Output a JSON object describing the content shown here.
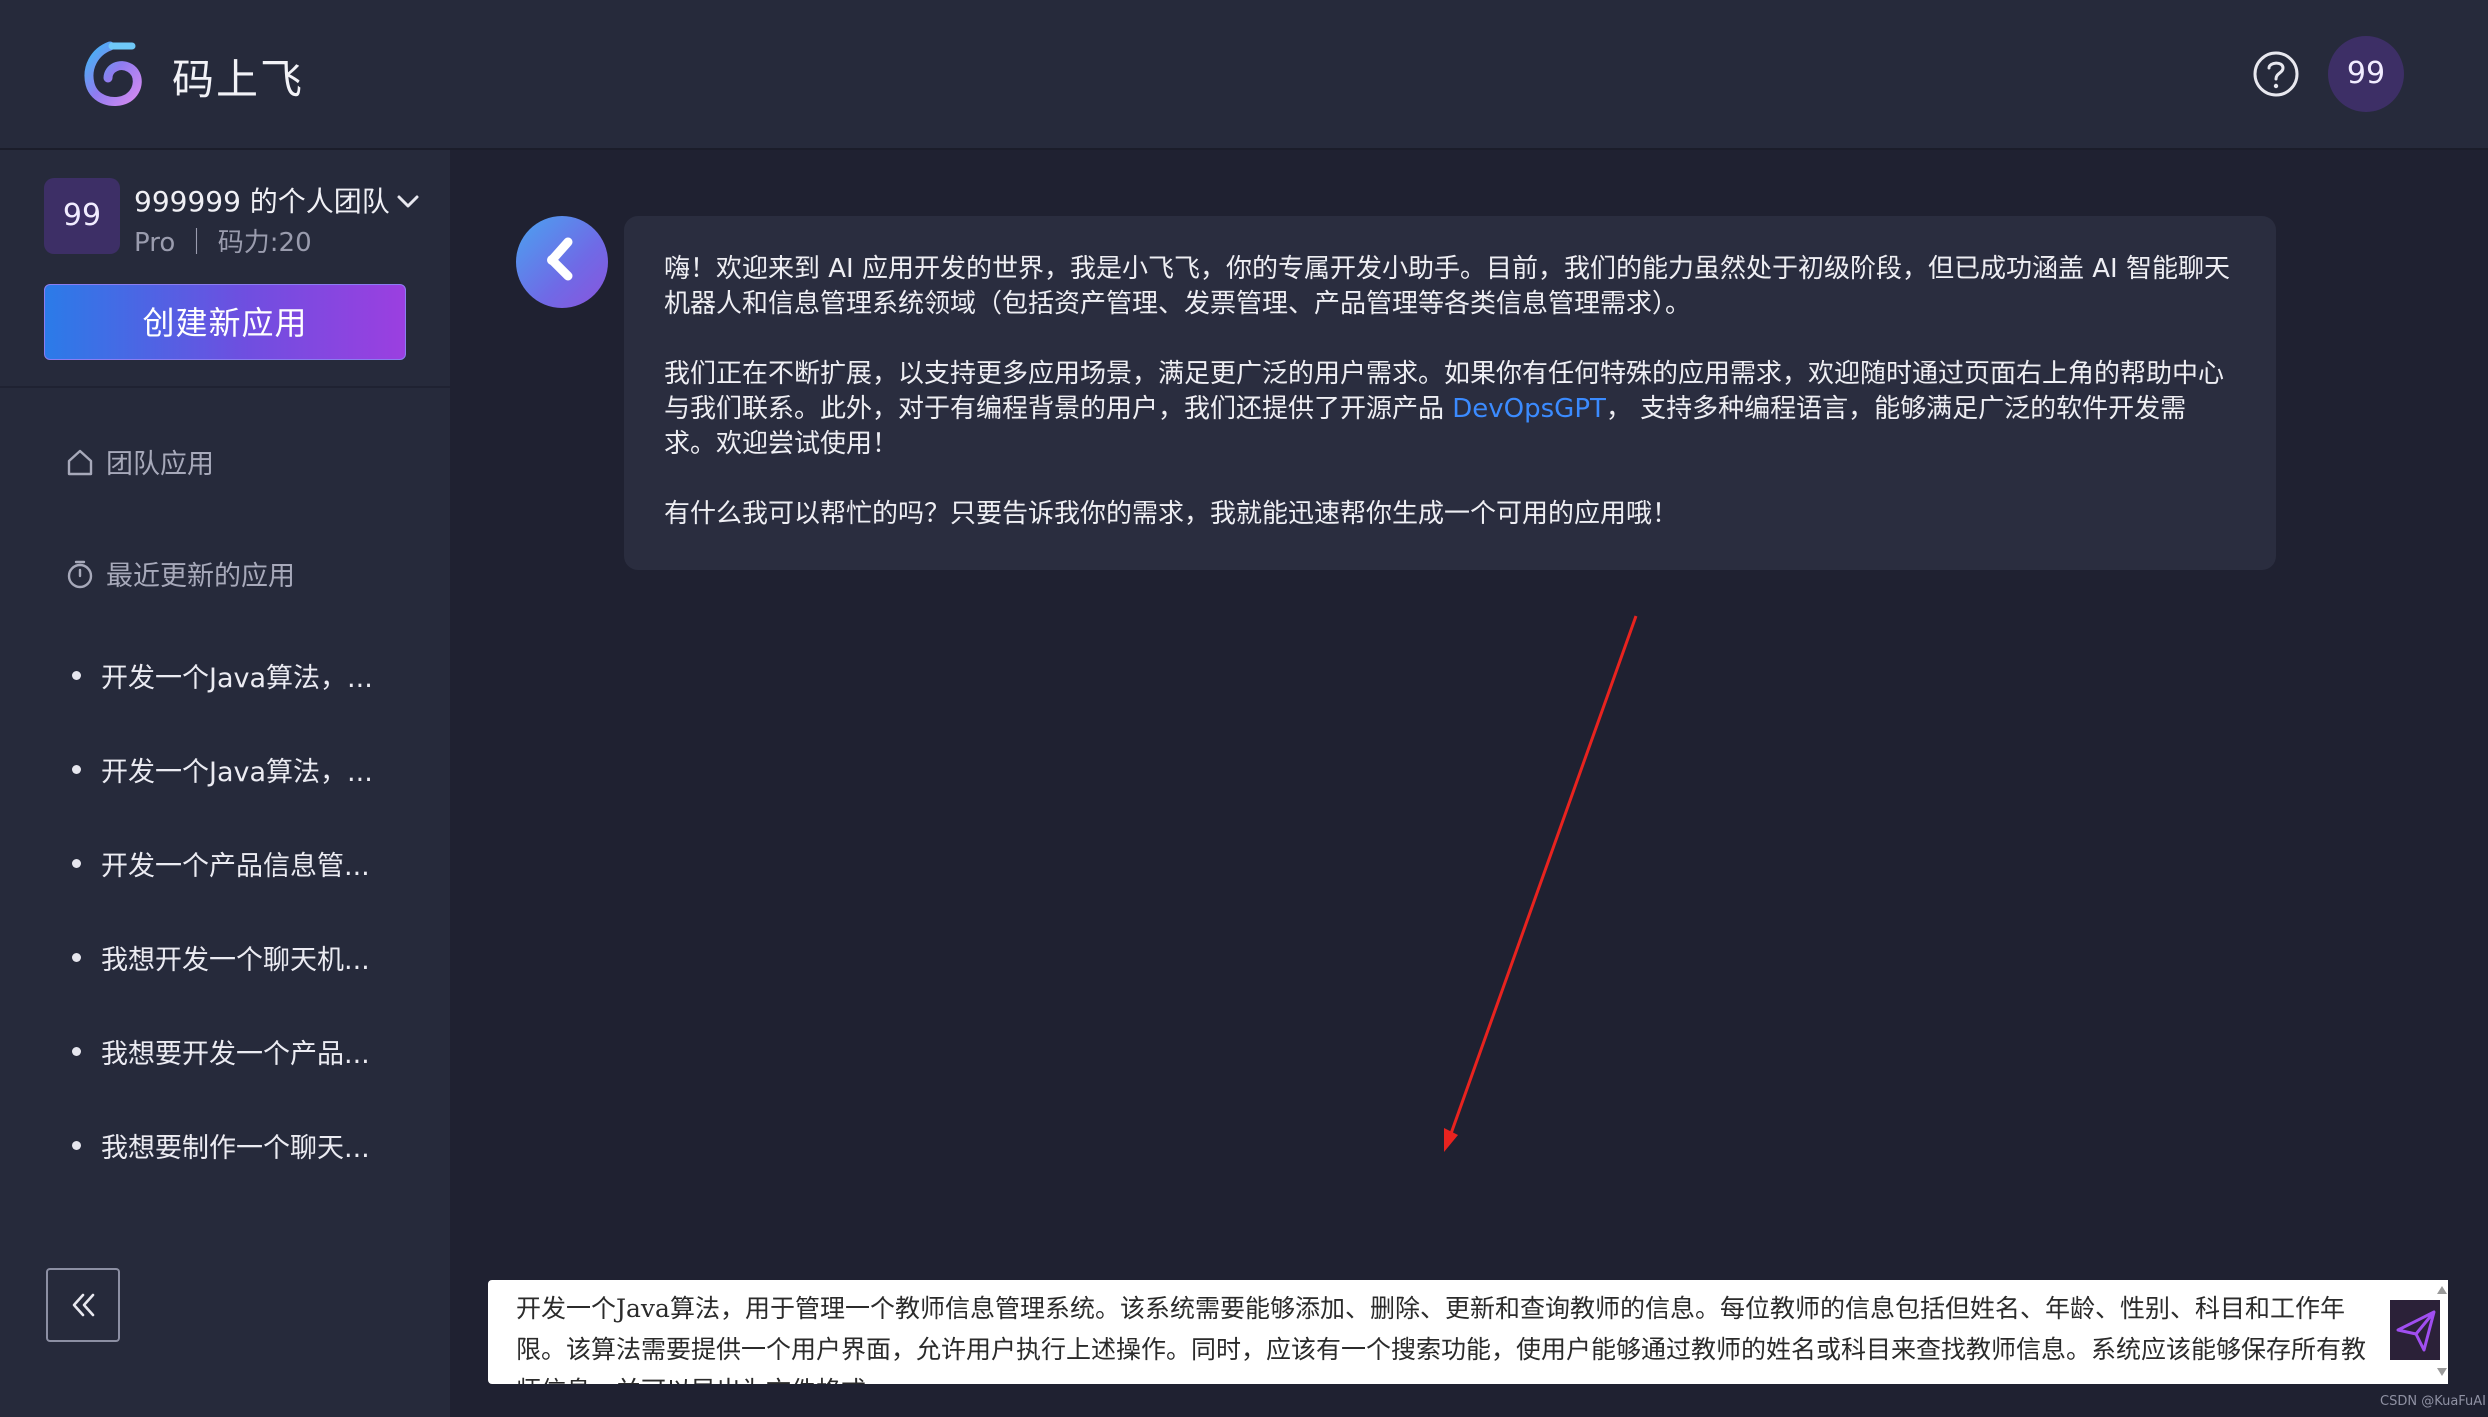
{
  "header": {
    "brand": "码上飞",
    "user_avatar": "99",
    "icons": {
      "logo": "brand-logo-icon",
      "help": "help-circle-icon"
    }
  },
  "sidebar": {
    "team": {
      "avatar": "99",
      "name": "999999 的个人团队",
      "meta": "Pro ｜ 码力:20"
    },
    "create_button": "创建新应用",
    "nav": [
      {
        "label": "团队应用",
        "icon": "home-icon"
      },
      {
        "label": "最近更新的应用",
        "icon": "clock-icon"
      }
    ],
    "recent_apps": [
      "开发一个Java算法，...",
      "开发一个Java算法，...",
      "开发一个产品信息管...",
      "我想开发一个聊天机...",
      "我想要开发一个产品...",
      "我想要制作一个聊天..."
    ]
  },
  "chat": {
    "welcome": {
      "p1": "嗨！欢迎来到 AI 应用开发的世界，我是小飞飞，你的专属开发小助手。目前，我们的能力虽然处于初级阶段，但已成功涵盖 AI 智能聊天机器人和信息管理系统领域（包括资产管理、发票管理、产品管理等各类信息管理需求）。",
      "p2_before": "我们正在不断扩展，以支持更多应用场景，满足更广泛的用户需求。如果你有任何特殊的应用需求，欢迎随时通过页面右上角的帮助中心与我们联系。此外，对于有编程背景的用户，我们还提供了开源产品 ",
      "p2_link": "DevOpsGPT",
      "p2_after": "， 支持多种编程语言，能够满足广泛的软件开发需求。欢迎尝试使用！",
      "p3": "有什么我可以帮忙的吗？只要告诉我你的需求，我就能迅速帮你生成一个可用的应用哦！"
    },
    "input_value": "开发一个Java算法，用于管理一个教师信息管理系统。该系统需要能够添加、删除、更新和查询教师的信息。每位教师的信息包括但姓名、年龄、性别、科目和工作年限。该算法需要提供一个用户界面，允许用户执行上述操作。同时，应该有一个搜索功能，使用户能够通过教师的姓名或科目来查找教师信息。系统应该能够保存所有教师信息，并可以导出为文件格式。"
  },
  "watermark": "CSDN @KuaFuAI",
  "colors": {
    "accent_blue": "#2b7be8",
    "accent_purple": "#9b3fe0",
    "annotation_arrow": "#e8231f"
  }
}
